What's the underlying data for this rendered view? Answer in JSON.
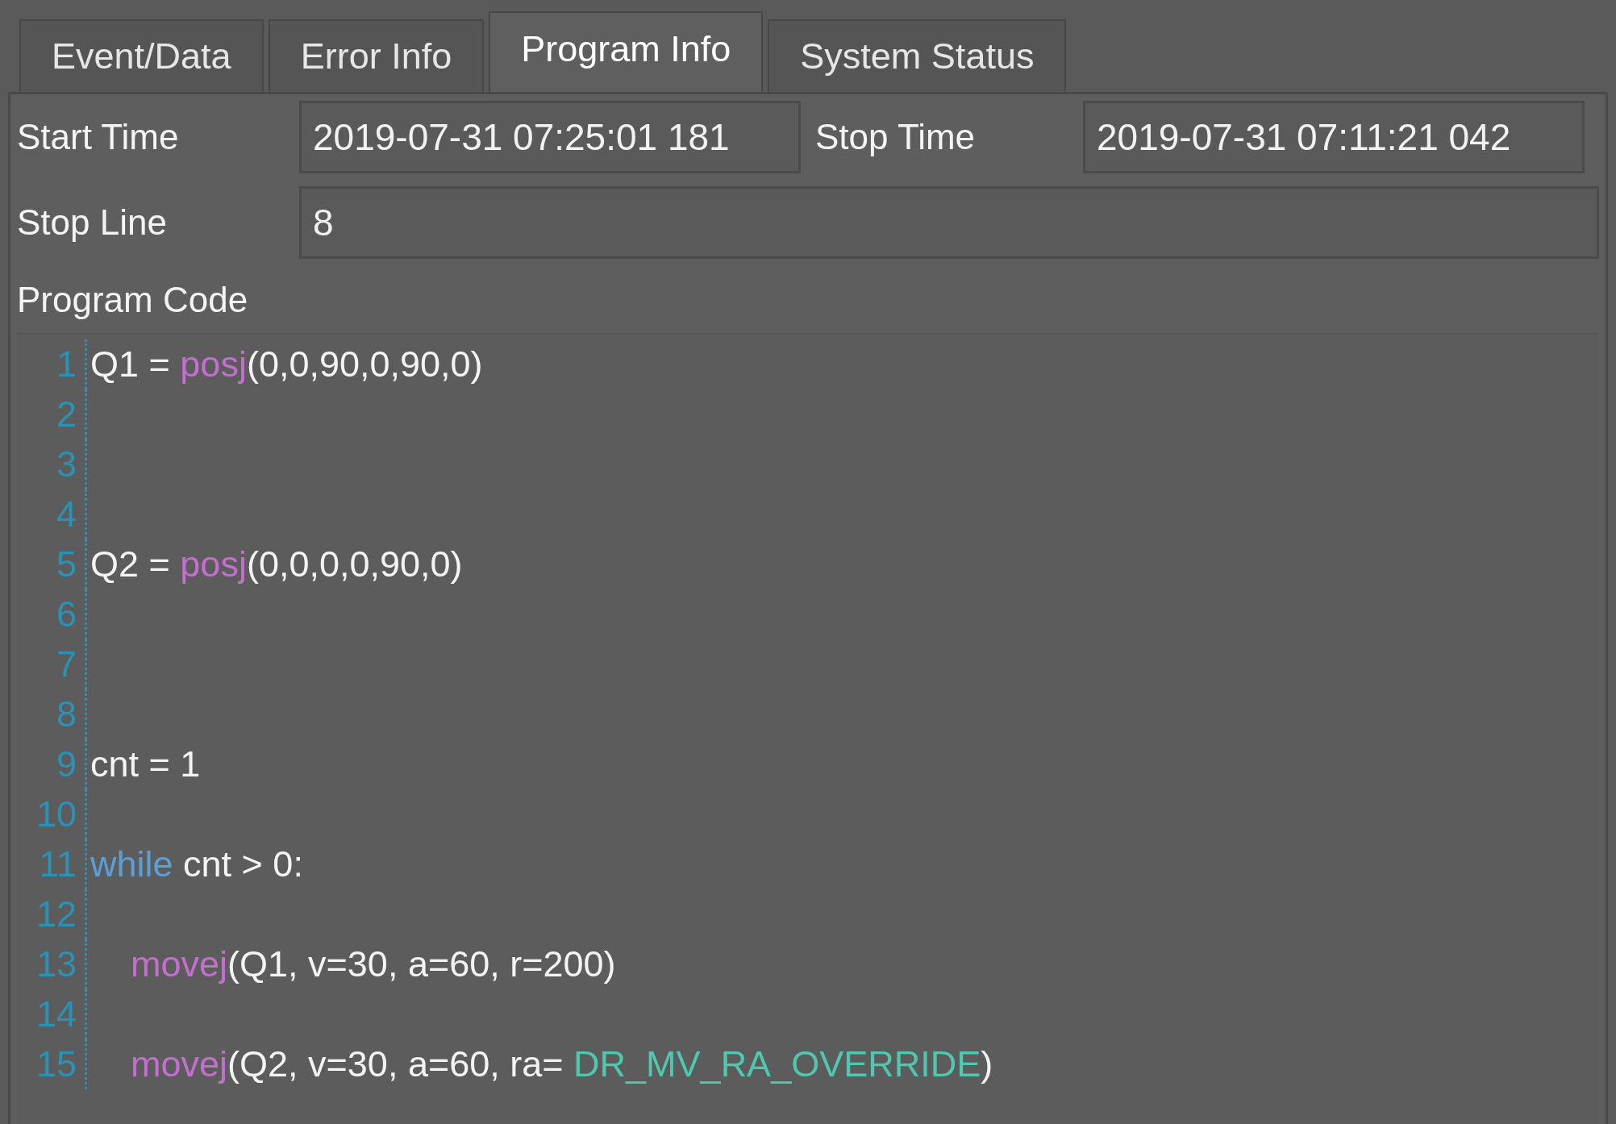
{
  "tabs": [
    {
      "label": "Event/Data",
      "selected": false
    },
    {
      "label": "Error Info",
      "selected": false
    },
    {
      "label": "Program Info",
      "selected": true
    },
    {
      "label": "System Status",
      "selected": false
    }
  ],
  "fields": {
    "start_time": {
      "label": "Start Time",
      "value": "2019-07-31 07:25:01 181"
    },
    "stop_time": {
      "label": "Stop Time",
      "value": "2019-07-31 07:11:21 042"
    },
    "stop_line": {
      "label": "Stop Line",
      "value": "8"
    }
  },
  "program_code": {
    "label": "Program Code",
    "lines": [
      {
        "number": "1",
        "indented": false,
        "tokens": [
          {
            "kind": "plain",
            "text": "Q1 = "
          },
          {
            "kind": "function",
            "text": "posj"
          },
          {
            "kind": "plain",
            "text": "(0,0,90,0,90,0)"
          }
        ]
      },
      {
        "number": "2"
      },
      {
        "number": "3"
      },
      {
        "number": "4"
      },
      {
        "number": "5",
        "indented": false,
        "tokens": [
          {
            "kind": "plain",
            "text": "Q2 = "
          },
          {
            "kind": "function",
            "text": "posj"
          },
          {
            "kind": "plain",
            "text": "(0,0,0,0,90,0)"
          }
        ]
      },
      {
        "number": "6"
      },
      {
        "number": "7"
      },
      {
        "number": "8"
      },
      {
        "number": "9",
        "indented": false,
        "tokens": [
          {
            "kind": "plain",
            "text": "cnt = 1"
          }
        ]
      },
      {
        "number": "10"
      },
      {
        "number": "11",
        "indented": false,
        "tokens": [
          {
            "kind": "keyword",
            "text": "while"
          },
          {
            "kind": "plain",
            "text": " cnt > 0:"
          }
        ]
      },
      {
        "number": "12"
      },
      {
        "number": "13",
        "indented": true,
        "tokens": [
          {
            "kind": "function",
            "text": "movej"
          },
          {
            "kind": "plain",
            "text": "(Q1, v=30, a=60, r=200)"
          }
        ]
      },
      {
        "number": "14"
      },
      {
        "number": "15",
        "indented": true,
        "tokens": [
          {
            "kind": "function",
            "text": "movej"
          },
          {
            "kind": "plain",
            "text": "(Q2, v=30, a=60, ra= "
          },
          {
            "kind": "constant",
            "text": "DR_MV_RA_OVERRIDE"
          },
          {
            "kind": "plain",
            "text": ")"
          }
        ]
      }
    ]
  }
}
